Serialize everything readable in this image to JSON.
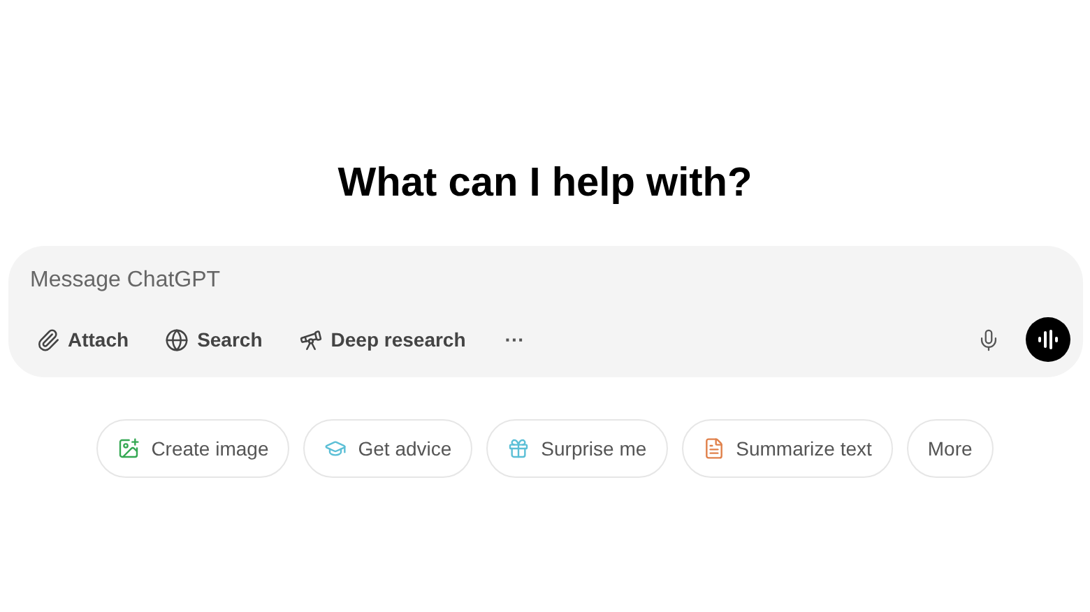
{
  "heading": "What can I help with?",
  "composer": {
    "placeholder": "Message ChatGPT",
    "tools": [
      {
        "kind": "attach",
        "label": "Attach"
      },
      {
        "kind": "search",
        "label": "Search"
      },
      {
        "kind": "research",
        "label": "Deep research"
      },
      {
        "kind": "more",
        "label": "···"
      }
    ]
  },
  "suggestions": [
    {
      "kind": "image",
      "label": "Create image",
      "color": "#35a853"
    },
    {
      "kind": "advice",
      "label": "Get advice",
      "color": "#5bbfd6"
    },
    {
      "kind": "gift",
      "label": "Surprise me",
      "color": "#5bbfd6"
    },
    {
      "kind": "document",
      "label": "Summarize text",
      "color": "#e0804a"
    },
    {
      "kind": "plain",
      "label": "More"
    }
  ]
}
